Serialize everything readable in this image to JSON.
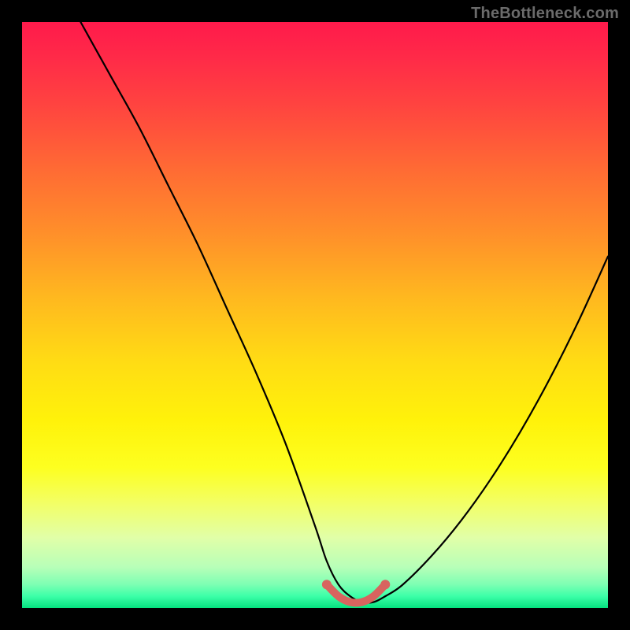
{
  "watermark": "TheBottleneck.com",
  "chart_data": {
    "type": "line",
    "title": "",
    "xlabel": "",
    "ylabel": "",
    "xlim": [
      0,
      100
    ],
    "ylim": [
      0,
      100
    ],
    "series": [
      {
        "name": "curve",
        "x": [
          10,
          15,
          20,
          25,
          30,
          35,
          40,
          45,
          50,
          52,
          54,
          56,
          58,
          60,
          62,
          65,
          70,
          75,
          80,
          85,
          90,
          95,
          100
        ],
        "y": [
          100,
          91,
          82,
          72,
          62,
          51,
          40,
          28,
          14,
          8,
          4,
          2,
          1,
          1,
          2,
          4,
          9,
          15,
          22,
          30,
          39,
          49,
          60
        ]
      },
      {
        "name": "highlight",
        "x": [
          52,
          54,
          56,
          58,
          60,
          62
        ],
        "y": [
          4,
          2,
          1,
          1,
          2,
          4
        ]
      }
    ],
    "gradient": {
      "top": "#ff1a4b",
      "mid": "#ffdc14",
      "bottom": "#05e27f"
    }
  }
}
